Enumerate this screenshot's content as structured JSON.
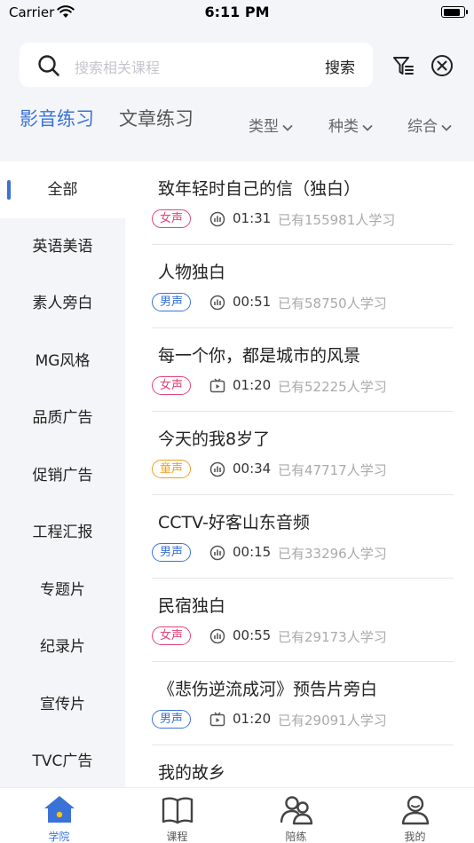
{
  "status_bar": {
    "carrier": "Carrier",
    "time": "6:11 PM",
    "battery_level": 0.9
  },
  "search": {
    "placeholder": "搜索相关课程",
    "button_label": "搜索"
  },
  "header": {
    "filter_icon": "filter-icon",
    "close_icon": "close-circle-icon"
  },
  "main_tabs": [
    {
      "label": "影音练习",
      "active": true
    },
    {
      "label": "文章练习",
      "active": false
    }
  ],
  "filters": [
    {
      "label": "类型"
    },
    {
      "label": "种类"
    },
    {
      "label": "综合"
    }
  ],
  "sidebar": {
    "items": [
      {
        "label": "全部",
        "selected": true
      },
      {
        "label": "英语美语"
      },
      {
        "label": "素人旁白"
      },
      {
        "label": "MG风格"
      },
      {
        "label": "品质广告"
      },
      {
        "label": "促销广告"
      },
      {
        "label": "工程汇报"
      },
      {
        "label": "专题片"
      },
      {
        "label": "纪录片"
      },
      {
        "label": "宣传片"
      },
      {
        "label": "TVC广告"
      }
    ]
  },
  "courses": [
    {
      "title": "致年轻时自己的信（独白）",
      "voice": "女声",
      "media": "audio",
      "duration": "01:31",
      "learners": "已有155981人学习"
    },
    {
      "title": "人物独白",
      "voice": "男声",
      "media": "audio",
      "duration": "00:51",
      "learners": "已有58750人学习"
    },
    {
      "title": "每一个你，都是城市的风景",
      "voice": "女声",
      "media": "video",
      "duration": "01:20",
      "learners": "已有52225人学习"
    },
    {
      "title": "今天的我8岁了",
      "voice": "童声",
      "media": "audio",
      "duration": "00:34",
      "learners": "已有47717人学习"
    },
    {
      "title": "CCTV-好客山东音频",
      "voice": "男声",
      "media": "audio",
      "duration": "00:15",
      "learners": "已有33296人学习"
    },
    {
      "title": "民宿独白",
      "voice": "女声",
      "media": "audio",
      "duration": "00:55",
      "learners": "已有29173人学习"
    },
    {
      "title": "《悲伤逆流成河》预告片旁白",
      "voice": "男声",
      "media": "video",
      "duration": "01:20",
      "learners": "已有29091人学习"
    },
    {
      "title": "我的故乡"
    }
  ],
  "voice_colors": {
    "女声": "#e0457b",
    "男声": "#3a72d8",
    "童声": "#f0a020"
  },
  "tabbar": {
    "items": [
      {
        "label": "学院",
        "icon": "home-icon",
        "active": true
      },
      {
        "label": "课程",
        "icon": "book-icon",
        "active": false
      },
      {
        "label": "陪练",
        "icon": "partners-icon",
        "active": false
      },
      {
        "label": "我的",
        "icon": "profile-icon",
        "active": false
      }
    ]
  },
  "colors": {
    "accent": "#3a72d8",
    "header_bg": "#f4f5f8",
    "tab_inactive": "#555555",
    "home_dot": "#f5c518"
  }
}
